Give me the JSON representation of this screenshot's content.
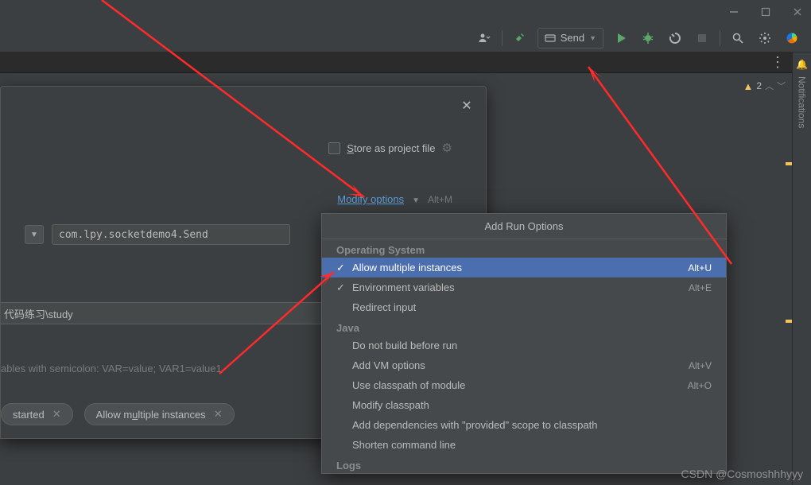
{
  "titlebar": {
    "minimize": "—",
    "maximize": "▢",
    "close": "✕"
  },
  "toolbar": {
    "user_icon": "user-dropdown",
    "hammer_icon": "build",
    "run_config_label": "Send",
    "play": "run",
    "bug": "debug",
    "coverage": "coverage",
    "stop": "stop",
    "search": "search",
    "gear": "settings",
    "brand": "brand"
  },
  "editor": {
    "warning_count": "2",
    "notifications_label": "Notifications"
  },
  "dialog": {
    "store_label": "Store as project file",
    "modify_label": "Modify options",
    "modify_shortcut": "Alt+M",
    "main_class": "com.lpy.socketdemo4.Send",
    "working_dir": "代码练习\\study",
    "env_hint": "ables with semicolon: VAR=value; VAR1=value1",
    "chip1": "started",
    "chip2": "Allow multiple instances"
  },
  "popup": {
    "title": "Add Run Options",
    "sections": {
      "os": "Operating System",
      "java": "Java",
      "logs": "Logs"
    },
    "items": {
      "allow_multi": {
        "label": "Allow multiple instances",
        "shortcut": "Alt+U",
        "checked": true
      },
      "env_vars": {
        "label": "Environment variables",
        "shortcut": "Alt+E",
        "checked": true
      },
      "redirect": {
        "label": "Redirect input",
        "shortcut": "",
        "checked": false
      },
      "no_build": {
        "label": "Do not build before run",
        "shortcut": "",
        "checked": false
      },
      "vm_opts": {
        "label": "Add VM options",
        "shortcut": "Alt+V",
        "checked": false
      },
      "classpath": {
        "label": "Use classpath of module",
        "shortcut": "Alt+O",
        "checked": false
      },
      "mod_cp": {
        "label": "Modify classpath",
        "shortcut": "",
        "checked": false
      },
      "provided": {
        "label": "Add dependencies with \"provided\" scope to classpath",
        "shortcut": "",
        "checked": false
      },
      "shorten": {
        "label": "Shorten command line",
        "shortcut": "",
        "checked": false
      }
    }
  },
  "watermark": "CSDN @Cosmoshhhyyy"
}
